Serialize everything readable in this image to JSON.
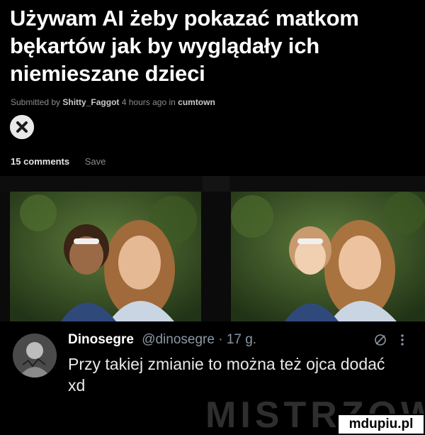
{
  "post": {
    "title": "Używam AI żeby pokazać matkom bękartów jak by wyglądały ich niemieszane dzieci",
    "meta_prefix": "Submitted by",
    "author": "Shitty_Faggot",
    "meta_middle": "4 hours ago in",
    "community": "cumtown",
    "comments_label": "15 comments",
    "save_label": "Save"
  },
  "tweet": {
    "name": "Dinosegre",
    "handle_time": "@dinosegre · 17 g.",
    "text": "Przy takiej zmianie to można też ojca dodać xd"
  },
  "watermark": "MISTRZOWIE",
  "badge": "mdupiu.pl",
  "icons": {
    "close": "close-x-icon",
    "mute": "slashed-circle-icon",
    "more": "more-vertical-icon"
  }
}
